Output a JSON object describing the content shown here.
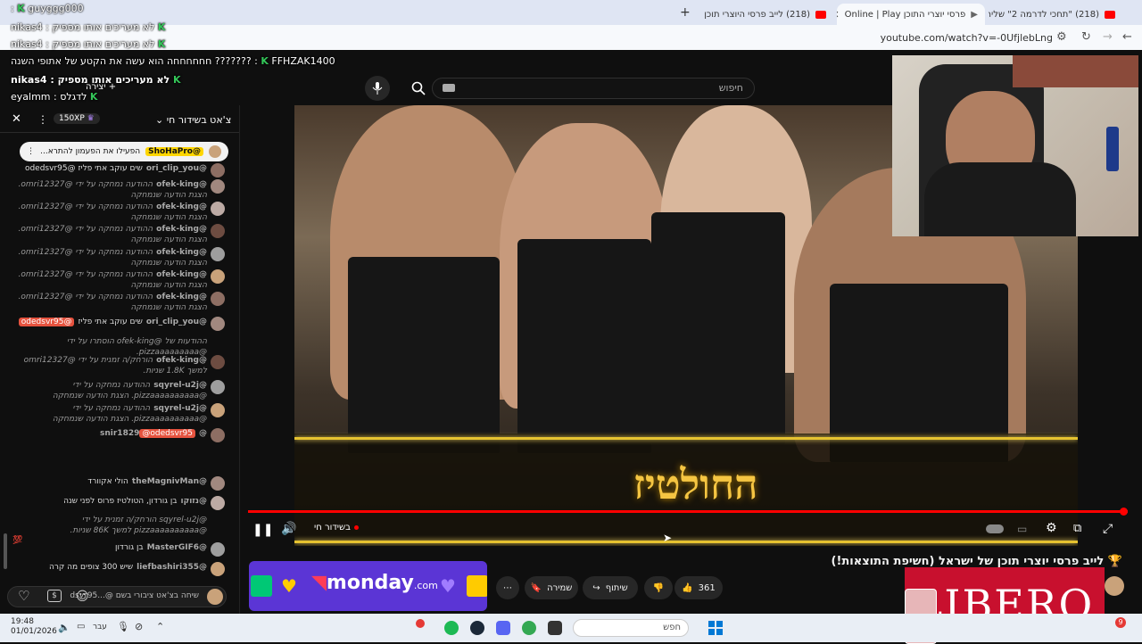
{
  "browser": {
    "tabs": [
      {
        "title": "(218) \"תחכי לדרמה 2\" שליח פי"
      },
      {
        "title": "פרסי יוצרי התוכן Online | Play"
      },
      {
        "title": "(218) לייב פרסי היוצרי תוכן"
      }
    ],
    "url": "youtube.com/watch?v=-0UfjlebLng"
  },
  "youtube": {
    "search_placeholder": "חיפוש",
    "video_title": "🏆 לייב פרסי יוצרי תוכן של ישראל (חשיפת התוצאות!)",
    "likes": "361",
    "share_label": "שיתוף",
    "save_label": "שמירה",
    "live_label": "בשידור חי",
    "progress_fraction": 0.996,
    "caption_text": "החולטיז"
  },
  "chat": {
    "title": "צ'אט בשידור חי",
    "xp": "150XP",
    "pinned_user": "@ShoHaPro",
    "pinned_text": "הפעילו את הפעמון להתרא...",
    "input_placeholder": "שיחה בצ'אט ציבורי בשם @...dsvr95",
    "messages": [
      {
        "author": "@ori_clip_you",
        "text": "שים עוקב אתי פליז @odedsvr95"
      },
      {
        "author": "@ofek-king",
        "text": "ההודעה נמחקה על ידי @omri12327. הצגת הודעה שנמחקה"
      },
      {
        "author": "@ofek-king",
        "text": "ההודעה נמחקה על ידי @omri12327. הצגת הודעה שנמחקה"
      },
      {
        "author": "@ofek-king",
        "text": "ההודעה נמחקה על ידי @omri12327. הצגת הודעה שנמחקה"
      },
      {
        "author": "@ofek-king",
        "text": "ההודעה נמחקה על ידי @omri12327. הצגת הודעה שנמחקה"
      },
      {
        "author": "@ofek-king",
        "text": "ההודעה נמחקה על ידי @omri12327. הצגת הודעה שנמחקה"
      },
      {
        "author": "@ofek-king",
        "text": "ההודעה נמחקה על ידי @omri12327. הצגת הודעה שנמחקה"
      },
      {
        "author": "@ori_clip_you",
        "text": "שים עוקב אתי פליז",
        "tag": "@odedsvr95"
      },
      {
        "author": "",
        "text": "ההודעות של @ofek-king הוסתרו על ידי @pizzaaaaaaaaa."
      },
      {
        "author": "@ofek-king",
        "text": "הורחק/ה זמנית על ידי @omri12327 למשך 1.8K שניות."
      },
      {
        "author": "@sqyrel-u2j",
        "text": "ההודעה נמחקה על ידי @pizzaaaaaaaaaa. הצגת הודעה שנמחקה"
      },
      {
        "author": "@sqyrel-u2j",
        "text": "ההודעה נמחקה על ידי @pizzaaaaaaaaaa. הצגת הודעה שנמחקה"
      },
      {
        "author": "@snir1829",
        "text": "",
        "tag": "@odedsvr95"
      },
      {
        "author": "@theMagnivMan",
        "text": "הולי אקוורד"
      },
      {
        "author": "@נזוקו",
        "text": "בן גורדון, הטולטיז פרוס לפני שנה"
      },
      {
        "author": "",
        "text": "@sqyrel-u2j הורחק/ה זמנית על ידי @pizzaaaaaaaaaa למשך 86K שניות."
      },
      {
        "author": "@MasterGIF6",
        "text": "בן גורדון"
      },
      {
        "author": "@liefbashiri355",
        "text": "שיש 300 צופים מה קרה"
      }
    ]
  },
  "overlays": [
    {
      "text": "guyggg000 :",
      "kind": "name"
    },
    {
      "text": "לא מעריכים אותו מספיק : nikas4",
      "kind": "msg"
    },
    {
      "text": "לא מעריכים אותו מספיק : nikas4",
      "kind": "msg"
    },
    {
      "text": "FFHZAK1400 : ??????? חחחחחחה הוא עשה את הקטע של אתופי השנה",
      "kind": "msg"
    },
    {
      "text": "לא מעריכים אותו מספיק : nikas4",
      "kind": "msg"
    },
    {
      "text": "לדגלס : eyalmm",
      "kind": "msg"
    }
  ],
  "create_label": "יצירה",
  "ads": {
    "monday": "monday",
    "monday_suffix": ".com",
    "libero": "LIBERO"
  },
  "taskbar": {
    "time": "19:48",
    "date": "01/01/2026",
    "search_placeholder": "חפש",
    "lang": "עבר",
    "badge": "9"
  },
  "colors": {
    "accent_red": "#ff0000",
    "gold": "#f5c542",
    "monday_purple": "#5b35d5",
    "libero_red": "#c8102e"
  }
}
